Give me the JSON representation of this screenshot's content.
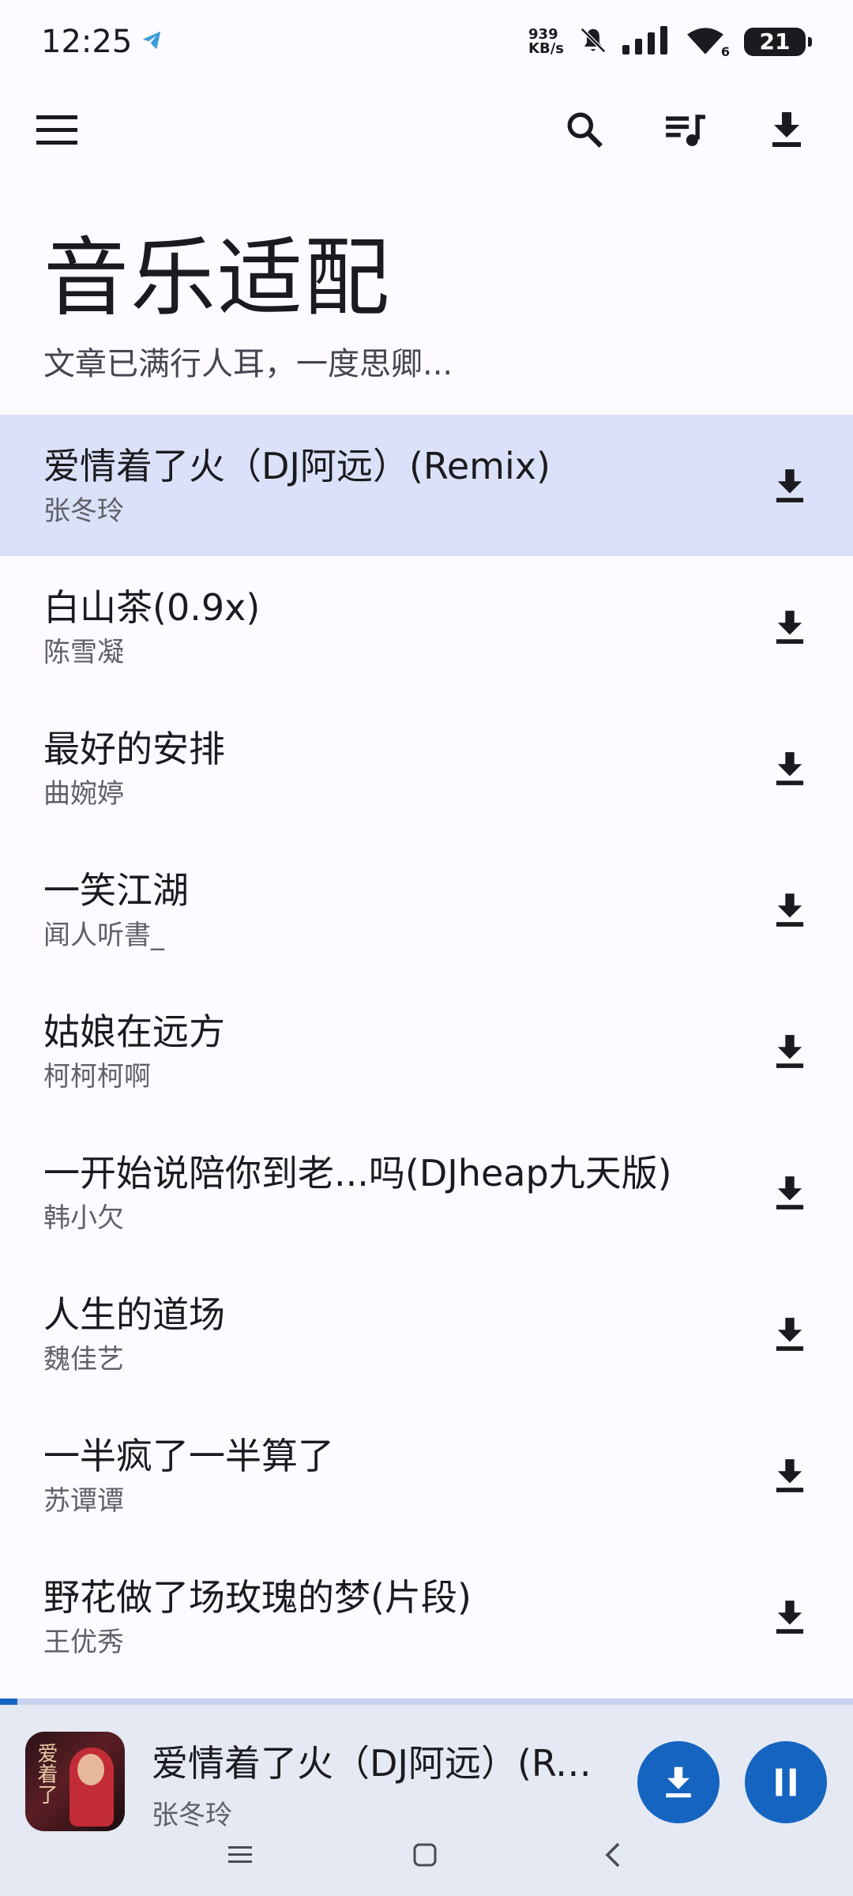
{
  "status_bar": {
    "time": "12:25",
    "net_speed_value": "939",
    "net_speed_unit": "KB/s",
    "wifi_badge": "6",
    "battery": "21"
  },
  "header": {
    "title": "音乐适配",
    "subtitle": "文章已满行人耳，一度思卿..."
  },
  "songs": [
    {
      "title": "爱情着了火（DJ阿远）(Remix)",
      "artist": "张冬玲",
      "active": true
    },
    {
      "title": "白山茶(0.9x)",
      "artist": "陈雪凝",
      "active": false
    },
    {
      "title": "最好的安排",
      "artist": "曲婉婷",
      "active": false
    },
    {
      "title": "一笑江湖",
      "artist": "闻人听書_",
      "active": false
    },
    {
      "title": "姑娘在远方",
      "artist": "柯柯柯啊",
      "active": false
    },
    {
      "title": "一开始说陪你到老...吗(DJheap九天版)",
      "artist": "韩小欠",
      "active": false
    },
    {
      "title": "人生的道场",
      "artist": "魏佳艺",
      "active": false
    },
    {
      "title": "一半疯了一半算了",
      "artist": "苏谭谭",
      "active": false
    },
    {
      "title": "野花做了场玫瑰的梦(片段)",
      "artist": "王优秀",
      "active": false
    }
  ],
  "player": {
    "title": "爱情着了火（DJ阿远）(Remix)",
    "artist": "张冬玲",
    "progress": 0.02,
    "cover_text": "爱着了"
  },
  "colors": {
    "accent": "#1565c0",
    "active_row": "#dbe1f8",
    "player_bg": "#e5e9f4"
  }
}
